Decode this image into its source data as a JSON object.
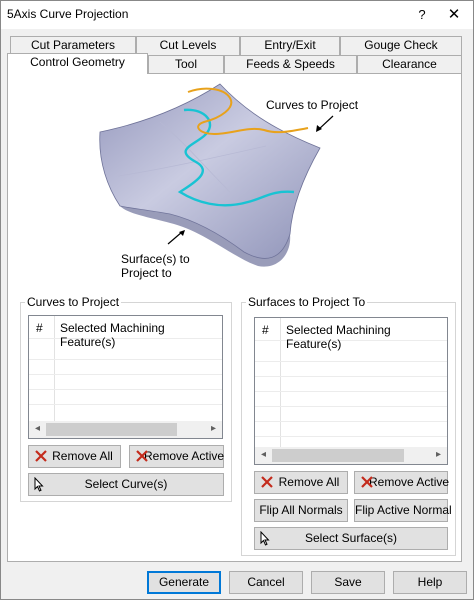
{
  "window": {
    "title": "5Axis Curve Projection",
    "help_glyph": "?",
    "close_glyph": "✕"
  },
  "tabs_row1": [
    "Cut Parameters",
    "Cut Levels",
    "Entry/Exit",
    "Gouge Check"
  ],
  "tabs_row2": [
    "Control Geometry",
    "Tool",
    "Feeds & Speeds",
    "Clearance"
  ],
  "active_tab": "Control Geometry",
  "illustration": {
    "curves_label": "Curves to Project",
    "surfaces_label": "Surface(s) to\nProject to",
    "colors": {
      "surface": "#a8abcc",
      "curve_projected": "#19c3d3",
      "curve_source": "#e8a21c"
    }
  },
  "curves_group": {
    "title": "Curves to Project",
    "columns": [
      "#",
      "Selected Machining Feature(s)"
    ],
    "rows": [],
    "remove_all": "Remove All",
    "remove_active": "Remove Active",
    "select": "Select Curve(s)"
  },
  "surfaces_group": {
    "title": "Surfaces to Project To",
    "columns": [
      "#",
      "Selected Machining Feature(s)"
    ],
    "rows": [],
    "remove_all": "Remove All",
    "remove_active": "Remove Active",
    "flip_all": "Flip All Normals",
    "flip_active": "Flip Active Normal",
    "select": "Select Surface(s)"
  },
  "footer": {
    "generate": "Generate",
    "cancel": "Cancel",
    "save": "Save",
    "help": "Help"
  },
  "icons": {
    "remove": "red-x-icon",
    "select": "mouse-cursor-icon",
    "scroll_left": "◂",
    "scroll_right": "▸"
  },
  "colors": {
    "accent": "#0078d7",
    "remove_x": "#c42b1c"
  }
}
